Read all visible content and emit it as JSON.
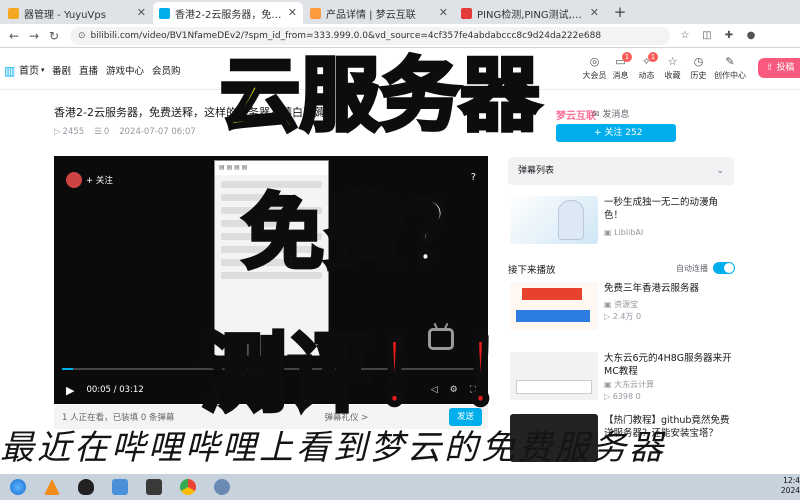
{
  "browser": {
    "tabs": [
      {
        "label": "器管理 - YuyuVps",
        "active": false,
        "favicon_color": "#f5a623"
      },
      {
        "label": "香港2-2云服务器，免费送释，这",
        "active": true,
        "favicon_color": "#00aeec"
      },
      {
        "label": "产品详情 | 梦云互联",
        "active": false,
        "favicon_color": "#ff9a3c"
      },
      {
        "label": "PING检测,PING测试,在线PING测",
        "active": false,
        "favicon_color": "#e23a3a"
      }
    ],
    "new_tab": "+",
    "url": "bilibili.com/video/BV1NfameDEv2/?spm_id_from=333.999.0.0&vd_source=4cf357fe4abdabccc8c9d24da222e688"
  },
  "site_header": {
    "home_label": "首页",
    "nav": [
      "番剧",
      "直播",
      "游戏中心",
      "会员购"
    ],
    "right_icons": [
      {
        "label": "大会员",
        "icon": "vip-icon"
      },
      {
        "label": "消息",
        "icon": "message-icon",
        "badge": "1"
      },
      {
        "label": "动态",
        "icon": "dynamic-icon",
        "badge": "1"
      },
      {
        "label": "收藏",
        "icon": "favorites-icon"
      },
      {
        "label": "历史",
        "icon": "history-icon"
      },
      {
        "label": "创作中心",
        "icon": "creator-icon"
      }
    ],
    "upload_label": "投稿"
  },
  "video": {
    "title": "香港2-2云服务器，免费送释，这样的服务器不薅白不薅",
    "views": "2455",
    "danmaku": "0",
    "date": "2024-07-07 06:07",
    "follow_overlay": "+ 关注",
    "time_current": "00:05",
    "time_total": "03:12",
    "progress": 0.026,
    "viewers_text": "1 人正在看，已装填 0 条弹幕",
    "send_label": "弹幕礼仪 >",
    "send_button": "发送"
  },
  "uploader": {
    "name": "梦云互联",
    "send_message": "发消息",
    "follow_label": "+ 关注 252"
  },
  "danmaku_list": {
    "label": "弹幕列表"
  },
  "autoplay": {
    "header": "接下来播放",
    "label": "自动连播"
  },
  "recommendations": [
    {
      "title": "一秒生成独一无二的动漫角色！",
      "uploader": "LiblibAI",
      "stats": ""
    },
    {
      "title": "免费三年香港云服务器",
      "uploader": "资源宝",
      "stats": "2.4万   0"
    },
    {
      "title": "大东云6元的4H8G服务器来开MC教程",
      "uploader": "大东云计算",
      "stats": "6398   0"
    },
    {
      "title": "【热门教程】github竟然免费送服务器？还能安装宝塔？",
      "uploader": "",
      "stats": ""
    }
  ],
  "overlay": {
    "line1": "云服务器",
    "line2": "免费？",
    "line3": "测评！！",
    "caption": "最近在哔哩哔哩上看到梦云的免费服务器"
  },
  "taskbar": {
    "clock": "12:4",
    "date": "2024"
  }
}
